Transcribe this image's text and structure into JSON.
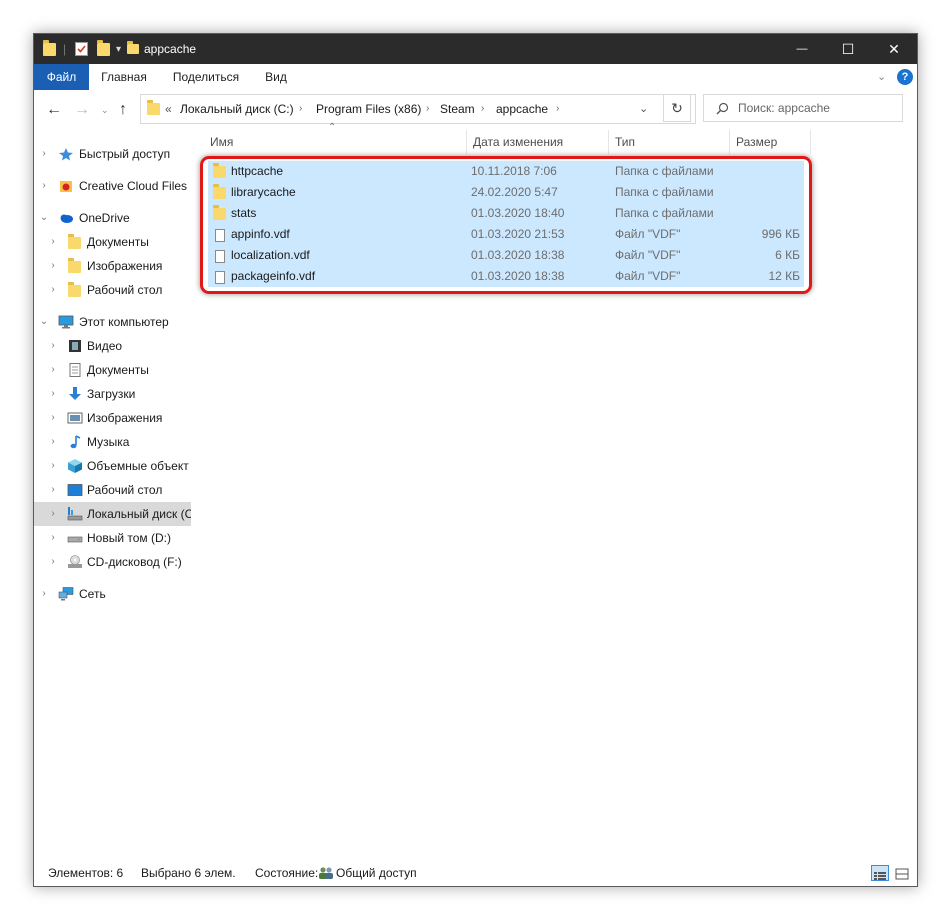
{
  "window": {
    "title": "appcache",
    "controls": {
      "minimize": "—",
      "maximize": "☐",
      "close": "✕"
    }
  },
  "ribbon": {
    "tabs": [
      "Файл",
      "Главная",
      "Поделиться",
      "Вид"
    ]
  },
  "address_bar": {
    "overflow": "«",
    "path": [
      "Локальный диск (C:)",
      "Program Files (x86)",
      "Steam",
      "appcache"
    ],
    "search_placeholder": "Поиск: appcache"
  },
  "sidebar": {
    "items": [
      {
        "label": "Быстрый доступ",
        "icon": "star-icon"
      },
      {
        "label": "Creative Cloud Files",
        "icon": "creative-cloud-icon"
      },
      {
        "label": "OneDrive",
        "icon": "cloud-icon"
      },
      {
        "label": "Документы",
        "icon": "folder-icon"
      },
      {
        "label": "Изображения",
        "icon": "folder-icon"
      },
      {
        "label": "Рабочий стол",
        "icon": "folder-icon"
      },
      {
        "label": "Этот компьютер",
        "icon": "computer-icon"
      },
      {
        "label": "Видео",
        "icon": "video-icon"
      },
      {
        "label": "Документы",
        "icon": "document-icon"
      },
      {
        "label": "Загрузки",
        "icon": "download-icon"
      },
      {
        "label": "Изображения",
        "icon": "pictures-icon"
      },
      {
        "label": "Музыка",
        "icon": "music-icon"
      },
      {
        "label": "Объемные объект",
        "icon": "3d-objects-icon"
      },
      {
        "label": "Рабочий стол",
        "icon": "desktop-icon"
      },
      {
        "label": "Локальный диск (С",
        "icon": "local-disk-icon"
      },
      {
        "label": "Новый том (D:)",
        "icon": "drive-icon"
      },
      {
        "label": "CD-дисковод (F:)",
        "icon": "cd-drive-icon"
      },
      {
        "label": "Сеть",
        "icon": "network-icon"
      }
    ]
  },
  "columns": {
    "name": "Имя",
    "date": "Дата изменения",
    "type": "Тип",
    "size": "Размер"
  },
  "files": [
    {
      "name": "httpcache",
      "date": "10.11.2018 7:06",
      "type": "Папка с файлами",
      "size": "",
      "kind": "folder"
    },
    {
      "name": "librarycache",
      "date": "24.02.2020 5:47",
      "type": "Папка с файлами",
      "size": "",
      "kind": "folder"
    },
    {
      "name": "stats",
      "date": "01.03.2020 18:40",
      "type": "Папка с файлами",
      "size": "",
      "kind": "folder"
    },
    {
      "name": "appinfo.vdf",
      "date": "01.03.2020 21:53",
      "type": "Файл \"VDF\"",
      "size": "996 КБ",
      "kind": "file"
    },
    {
      "name": "localization.vdf",
      "date": "01.03.2020 18:38",
      "type": "Файл \"VDF\"",
      "size": "6 КБ",
      "kind": "file"
    },
    {
      "name": "packageinfo.vdf",
      "date": "01.03.2020 18:38",
      "type": "Файл \"VDF\"",
      "size": "12 КБ",
      "kind": "file"
    }
  ],
  "status": {
    "count": "Элементов: 6",
    "selected": "Выбрано 6 элем.",
    "state_label": "Состояние:",
    "state_value": "Общий доступ"
  },
  "colors": {
    "titlebar": "#2b2b2b",
    "file_tab": "#1a5fb4",
    "selection": "#cce8ff",
    "highlight": "#e01818"
  }
}
